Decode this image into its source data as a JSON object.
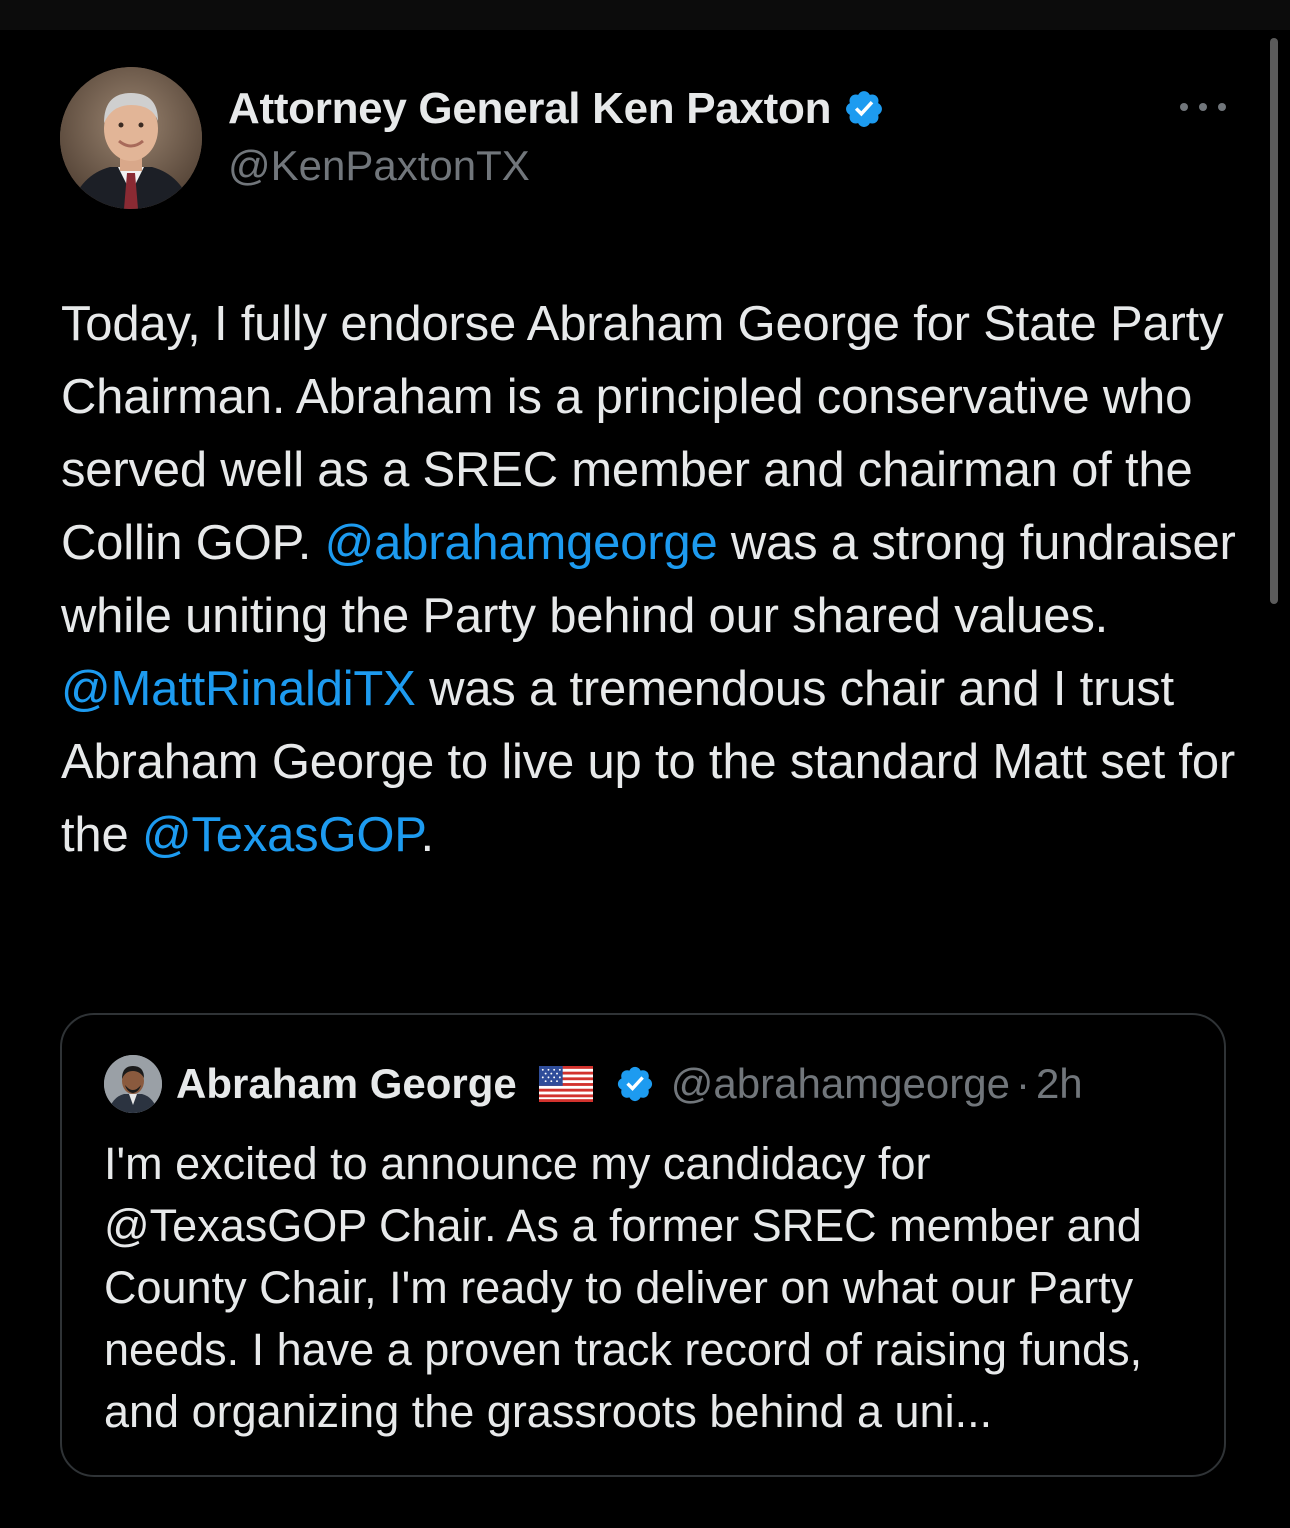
{
  "tweet": {
    "author_name": "Attorney General Ken Paxton",
    "author_handle": "@KenPaxtonTX",
    "verified_icon": "verified-badge-icon",
    "more_icon": "more-options-icon",
    "text_segments": [
      {
        "text": "Today, I fully endorse Abraham George for State Party Chairman. Abraham is a principled conservative who served well as a SREC member and chairman of the Collin GOP. ",
        "type": "text"
      },
      {
        "text": "@abrahamgeorge",
        "type": "mention"
      },
      {
        "text": " was a strong fundraiser while uniting the Party behind our shared values. ",
        "type": "text"
      },
      {
        "text": "@MattRinaldiTX",
        "type": "mention"
      },
      {
        "text": " was a tremendous chair and I trust Abraham George to live up to the standard Matt set for the ",
        "type": "text"
      },
      {
        "text": "@TexasGOP",
        "type": "mention"
      },
      {
        "text": ".",
        "type": "text"
      }
    ]
  },
  "quoted_tweet": {
    "author_name": "Abraham George",
    "flag": "🇺🇸",
    "verified_icon": "verified-badge-icon",
    "author_handle": "@abrahamgeorge",
    "separator": "·",
    "time": "2h",
    "text": "I'm excited to announce my candidacy for @TexasGOP Chair.  As a former SREC member and County Chair, I'm ready to deliver on what our Party needs. I have a proven track record of raising funds, and organizing the grassroots behind a uni..."
  },
  "colors": {
    "background": "#000000",
    "text_primary": "#e7e9ea",
    "text_secondary": "#71767b",
    "link": "#1d9bf0",
    "border": "#2f3336",
    "verified": "#1d9bf0"
  }
}
